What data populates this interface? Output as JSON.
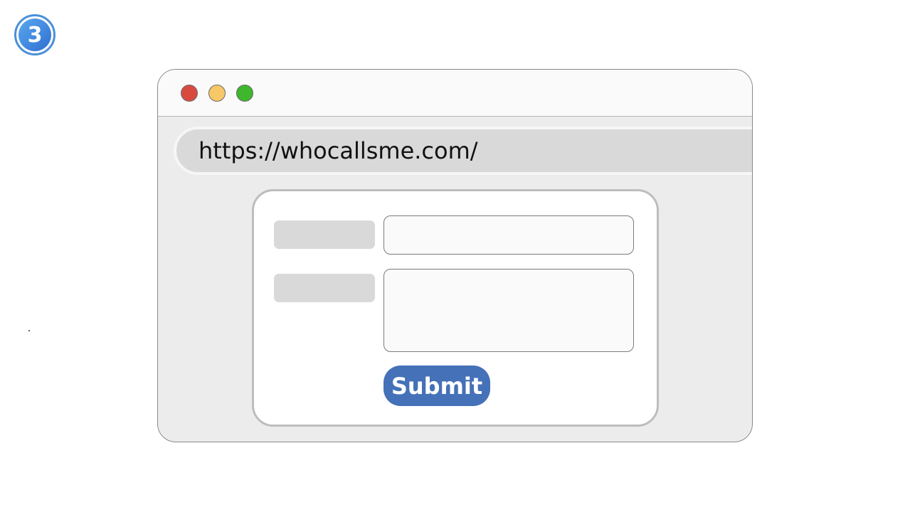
{
  "step_badge": {
    "number": "3",
    "color": "#3a80d8"
  },
  "window": {
    "controls": {
      "close_color": "#d94a3e",
      "minimize_color": "#f7c768",
      "maximize_color": "#3fb62e"
    },
    "address_bar": {
      "url": "https://whocallsme.com/"
    }
  },
  "form": {
    "fields": [
      {
        "type": "text-input",
        "label": ""
      },
      {
        "type": "textarea",
        "label": ""
      }
    ],
    "submit_label": "Submit",
    "submit_color": "#4471b8"
  }
}
